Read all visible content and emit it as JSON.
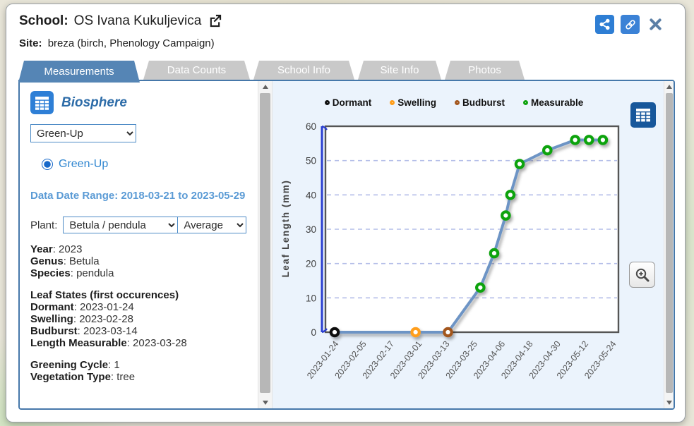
{
  "header": {
    "school_label": "School:",
    "school_name": "OS Ivana Kukuljevica",
    "site_label": "Site:",
    "site_value": "breza (birch, Phenology Campaign)"
  },
  "tabs": [
    {
      "label": "Measurements",
      "active": true
    },
    {
      "label": "Data Counts",
      "active": false
    },
    {
      "label": "School Info",
      "active": false
    },
    {
      "label": "Site Info",
      "active": false
    },
    {
      "label": "Photos",
      "active": false
    }
  ],
  "sidebar": {
    "protocol_title": "Biosphere",
    "protocol_select_value": "Green-Up",
    "radio_label": "Green-Up",
    "radio_selected": true,
    "date_range_label": "Data Date Range:",
    "date_range_value": "2018-03-21 to 2023-05-29",
    "plant_label": "Plant:",
    "plant_select_value": "Betula / pendula",
    "aggregate_select_value": "Average",
    "info_groups": [
      {
        "heading": null,
        "rows": [
          {
            "label": "Year",
            "value": "2023"
          },
          {
            "label": "Genus",
            "value": "Betula"
          },
          {
            "label": "Species",
            "value": "pendula"
          }
        ]
      },
      {
        "heading": "Leaf States (first occurences)",
        "rows": [
          {
            "label": "Dormant",
            "value": "2023-01-24"
          },
          {
            "label": "Swelling",
            "value": "2023-02-28"
          },
          {
            "label": "Budburst",
            "value": "2023-03-14"
          },
          {
            "label": "Length Measurable",
            "value": "2023-03-28"
          }
        ]
      },
      {
        "heading": null,
        "rows": [
          {
            "label": "Greening Cycle",
            "value": "1"
          },
          {
            "label": "Vegetation Type",
            "value": "tree"
          }
        ]
      }
    ]
  },
  "chart_data": {
    "type": "line",
    "title": "",
    "xlabel": "",
    "ylabel": "Leaf Length (mm)",
    "ylim": [
      0,
      60
    ],
    "yticks": [
      0,
      10,
      20,
      30,
      40,
      50,
      60
    ],
    "x_tick_labels": [
      "2023-01-24",
      "2023-02-05",
      "2023-02-17",
      "2023-03-01",
      "2023-03-13",
      "2023-03-25",
      "2023-04-06",
      "2023-04-18",
      "2023-04-30",
      "2023-05-12",
      "2023-05-24"
    ],
    "x_axis_span_days": 120,
    "grid": true,
    "legend_position": "top",
    "legend": [
      {
        "label": "Dormant",
        "color": "#111111"
      },
      {
        "label": "Swelling",
        "color": "#ff9e1b"
      },
      {
        "label": "Budburst",
        "color": "#a3571f"
      },
      {
        "label": "Measurable",
        "color": "#10a310"
      }
    ],
    "line_color": "#6d94c5",
    "grid_color": "#b4bee8",
    "axis_color": "#2b3fd0",
    "plot_border_color": "#555555",
    "points": [
      {
        "date": "2023-01-24",
        "day": 0,
        "value": 0,
        "state": "Dormant"
      },
      {
        "date": "2023-02-28",
        "day": 35,
        "value": 0,
        "state": "Swelling"
      },
      {
        "date": "2023-03-14",
        "day": 49,
        "value": 0,
        "state": "Budburst"
      },
      {
        "date": "2023-03-28",
        "day": 63,
        "value": 13,
        "state": "Measurable"
      },
      {
        "date": "2023-04-03",
        "day": 69,
        "value": 23,
        "state": "Measurable"
      },
      {
        "date": "2023-04-08",
        "day": 74,
        "value": 34,
        "state": "Measurable"
      },
      {
        "date": "2023-04-10",
        "day": 76,
        "value": 40,
        "state": "Measurable"
      },
      {
        "date": "2023-04-14",
        "day": 80,
        "value": 49,
        "state": "Measurable"
      },
      {
        "date": "2023-04-26",
        "day": 92,
        "value": 53,
        "state": "Measurable"
      },
      {
        "date": "2023-05-08",
        "day": 104,
        "value": 56,
        "state": "Measurable"
      },
      {
        "date": "2023-05-14",
        "day": 110,
        "value": 56,
        "state": "Measurable"
      },
      {
        "date": "2023-05-20",
        "day": 116,
        "value": 56,
        "state": "Measurable"
      }
    ]
  }
}
